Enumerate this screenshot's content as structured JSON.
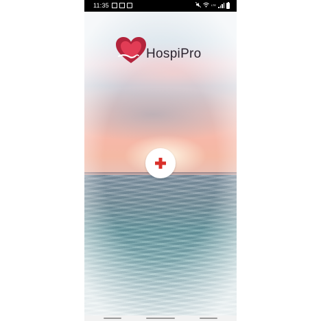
{
  "status_bar": {
    "time": "11:35",
    "network": "LTE",
    "icons": [
      "image-icon",
      "sim-icon",
      "save-icon",
      "mute-icon",
      "wifi-icon",
      "signal-icon",
      "battery-icon"
    ]
  },
  "app": {
    "name": "HospiPro",
    "logo_icon": "heart-hand-icon",
    "colors": {
      "brand": "#b3243c",
      "plus": "#d9302a"
    }
  },
  "main": {
    "action_button_icon": "plus-icon"
  },
  "nav_bar": {
    "items": [
      "recents-button",
      "home-button",
      "back-button"
    ]
  }
}
